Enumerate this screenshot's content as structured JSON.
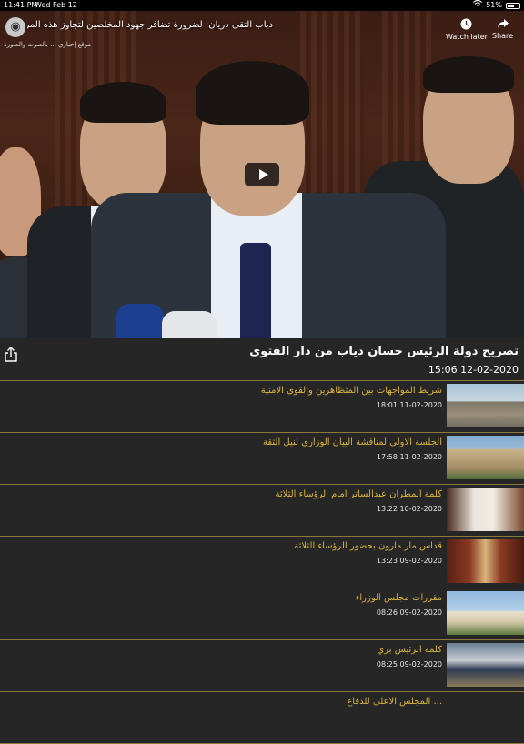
{
  "status_bar": {
    "time": "11:41 PM",
    "date": "Wed Feb 12",
    "wifi_icon": "wifi-icon",
    "battery": "51%"
  },
  "video": {
    "title": "دياب التقى دريان: لضرورة تضافر جهود المخلصين لتجاوز هذه المرحلة الصعبة",
    "logo_sub": "موقع إخباري ... بالصوت والصورة",
    "watch_later": "Watch later",
    "share": "Share"
  },
  "header": {
    "title": "تصريح دولة الرئيس حسان  دياب من دار الفتوى",
    "datetime": "15:06 12-02-2020"
  },
  "items": [
    {
      "title": "شريط المواجهات بين المتظاهرين والقوى الامنية",
      "datetime": "18:01 11-02-2020"
    },
    {
      "title": "الجلسة الاولى لمناقشة البيان الوزاري لنيل الثقة",
      "datetime": "17:58 11-02-2020"
    },
    {
      "title": "كلمة المطران عبدالساتر امام الرؤساء الثلاثة",
      "datetime": "13:22 10-02-2020"
    },
    {
      "title": "قداس مار مارون بحضور الرؤساء الثلاثة",
      "datetime": "13:23 09-02-2020"
    },
    {
      "title": "مقررات مجلس الوزراء",
      "datetime": "08:26 09-02-2020"
    },
    {
      "title": "كلمة الرئيس بري",
      "datetime": "08:25 09-02-2020"
    },
    {
      "title": "... المجلس الاعلى للدفاع",
      "datetime": ""
    }
  ]
}
